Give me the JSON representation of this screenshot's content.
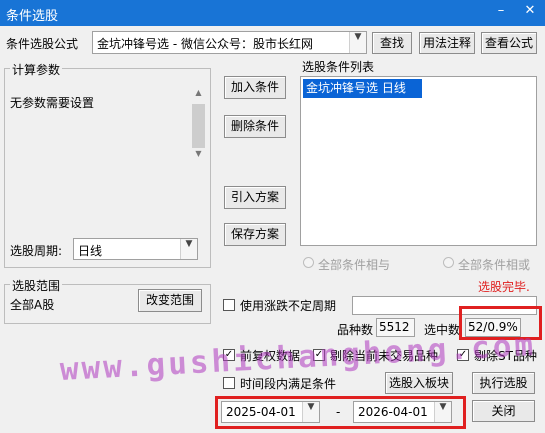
{
  "window": {
    "title": "条件选股",
    "minimize": "–",
    "close": "✕"
  },
  "formula_row": {
    "label": "条件选股公式",
    "formula_value": "金坑冲锋号选  -  微信公众号：股市长红网",
    "find_btn": "查找",
    "usage_btn": "用法注释",
    "view_formula_btn": "查看公式"
  },
  "params": {
    "title": "计算参数",
    "text": "无参数需要设置",
    "period_label": "选股周期:",
    "period_value": "日线"
  },
  "actions": {
    "add": "加入条件",
    "delete": "删除条件",
    "import": "引入方案",
    "save": "保存方案"
  },
  "conditions": {
    "title": "选股条件列表",
    "items": [
      "金坑冲锋号选  日线"
    ],
    "and_label": "全部条件相与",
    "or_label": "全部条件相或",
    "status": "选股完毕."
  },
  "range": {
    "title": "选股范围",
    "value": "全部A股",
    "change_btn": "改变范围"
  },
  "options": {
    "use_var_period": "使用涨跌不定周期",
    "count_label": "品种数",
    "count_value": "5512",
    "selected_label": "选中数",
    "selected_value": "52/0.9%",
    "pre_adjust": "前复权数据",
    "exclude_untraded": "剔除当前未交易品种",
    "exclude_st": "剔除ST品种",
    "period_condition": "时间段内满足条件",
    "to_block_btn": "选股入板块",
    "execute_btn": "执行选股",
    "date_from": "2025-04-01",
    "date_sep": "-",
    "date_to": "2026-04-01",
    "close_btn": "关闭"
  },
  "watermark": "www.gushichanghong.com",
  "colors": {
    "titlebar": "#1874d6",
    "selection": "#0a64d6",
    "highlight_box": "#e02020",
    "status_text": "#e02020",
    "watermark": "#b03abf"
  }
}
